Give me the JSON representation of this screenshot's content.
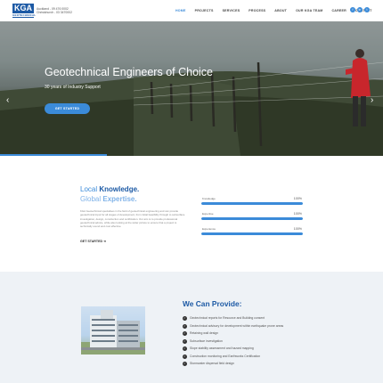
{
  "header": {
    "logo": "KGA",
    "logo_sub": "GEOTECHNICAL",
    "contact_lines": [
      "Auckland - 09 476 0002",
      "Christchurch - 03 3470002"
    ],
    "nav": [
      "HOME",
      "PROJECTS",
      "SERVICES",
      "PROCESS",
      "ABOUT",
      "OUR KGA TEAM",
      "CAREER",
      "CONTACT"
    ],
    "active_nav": "HOME",
    "social_icons": [
      "facebook-icon",
      "linkedin-icon",
      "twitter-icon"
    ],
    "accent_color": "#3b8bd9",
    "brand_color": "#1d5aa5"
  },
  "hero": {
    "title": "Geotechnical Engineers of Choice",
    "subtitle": "30 years of Industry Support",
    "button": "GET STARTED",
    "prev_glyph": "‹",
    "next_glyph": "›"
  },
  "local": {
    "title_plain": "Local ",
    "title_bold": "Knowledge.",
    "title2_light": "Global ",
    "title2_bold": "Expertise.",
    "body": "KGA Geotechnical specialises in the field of geotechnical engineering and can provide geotechnical input for all stages of development, from initial feasibility through to subsurface investigation, design, construction and certification. Our aim is to provide professional geotechnical advice, while also looking at the wider picture to ensure that a project is technically sound and cost effective.",
    "link": "GET STARTED",
    "link_arrow": "➔",
    "skills": [
      {
        "label": "Knowledge",
        "value": "100%",
        "fill": 1.0
      },
      {
        "label": "Expertise",
        "value": "100%",
        "fill": 1.0
      },
      {
        "label": "Experience",
        "value": "100%",
        "fill": 1.0
      }
    ]
  },
  "provide": {
    "title_plain": "We Can ",
    "title_bold": "Provide:",
    "check_glyph": "✓",
    "services": [
      "Geotechnical reports for Resource and Building consent",
      "Geotechnical advisory for development within earthquake prone areas",
      "Retaining wall design",
      "Subsurface investigation",
      "Slope stability assessment and hazard mapping",
      "Construction monitoring and Earthworks Certification",
      "Stormwater dispersal field design"
    ]
  }
}
